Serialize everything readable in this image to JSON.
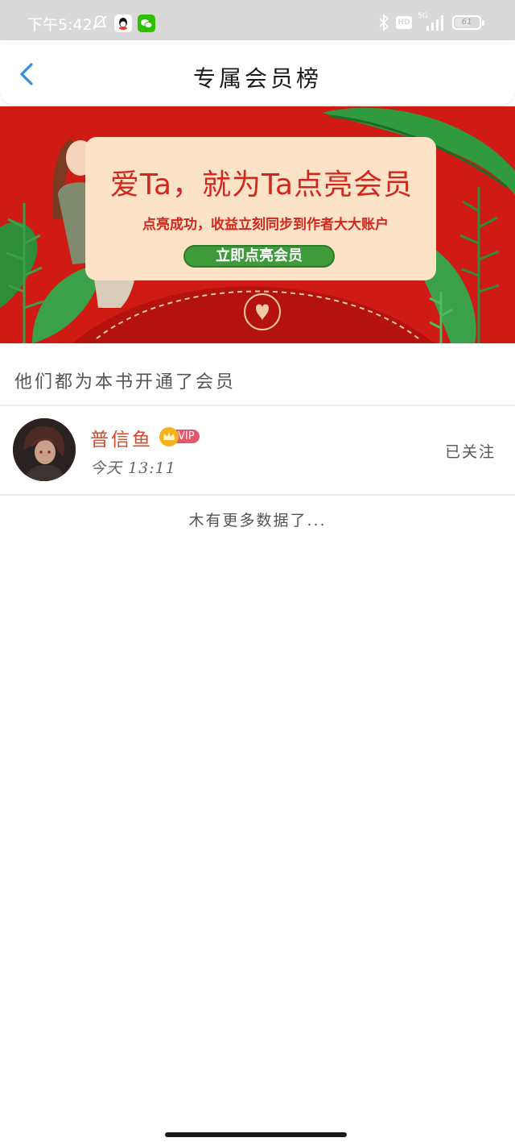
{
  "status_bar": {
    "time": "下午5:42",
    "network": "5G",
    "hd_label": "HD",
    "battery": "61",
    "battery_level": 0.61
  },
  "header": {
    "title": "专属会员榜"
  },
  "banner": {
    "headline": "爱Ta，就为Ta点亮会员",
    "subtitle": "点亮成功，收益立刻同步到作者大大账户",
    "button_label": "立即点亮会员"
  },
  "section": {
    "title": "他们都为本书开通了会员"
  },
  "members": [
    {
      "name": "普信鱼",
      "badge": "VIP",
      "time": "今天 13:11",
      "follow_status": "已关注"
    }
  ],
  "footer": {
    "no_more_text": "木有更多数据了..."
  },
  "colors": {
    "accent_blue": "#2f8ee0",
    "banner_red": "#cf1b14",
    "name_red": "#d5482b",
    "vip_pink": "#e8566b"
  }
}
